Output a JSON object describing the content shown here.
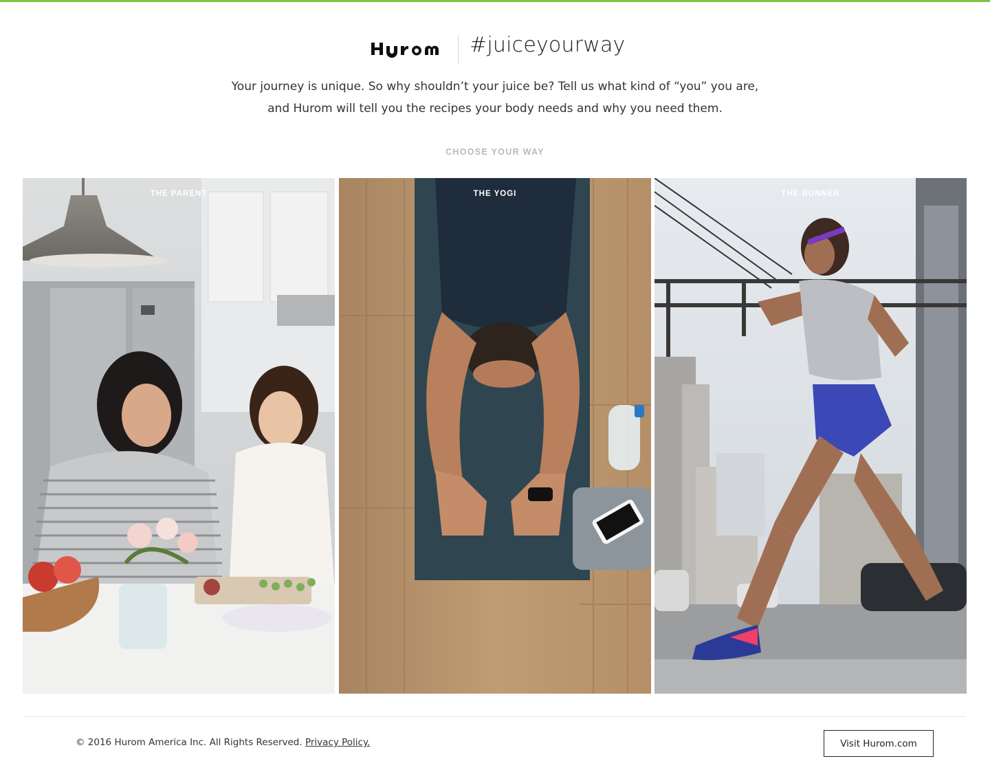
{
  "accent_color": "#7cc242",
  "brand": {
    "logo_text": "Hurom",
    "hashtag": "#juiceyourway"
  },
  "intro": {
    "line1": "Your journey is unique. So why shouldn’t your juice be? Tell us what kind of “you” you are,",
    "line2": "and Hurom will tell you the recipes your body needs and why you need them."
  },
  "choose_heading": "CHOOSE YOUR WAY",
  "panels": [
    {
      "label": "THE PARENT",
      "image": "mother-and-daughter-cooking-photo"
    },
    {
      "label": "THE YOGI",
      "image": "man-stretching-on-yoga-mat-photo"
    },
    {
      "label": "THE RUNNER",
      "image": "woman-running-in-city-street-photo"
    }
  ],
  "footer": {
    "copyright": "© 2016 Hurom America Inc. All Rights Reserved.",
    "privacy_link": "Privacy Policy.",
    "visit_button": "Visit Hurom.com"
  }
}
